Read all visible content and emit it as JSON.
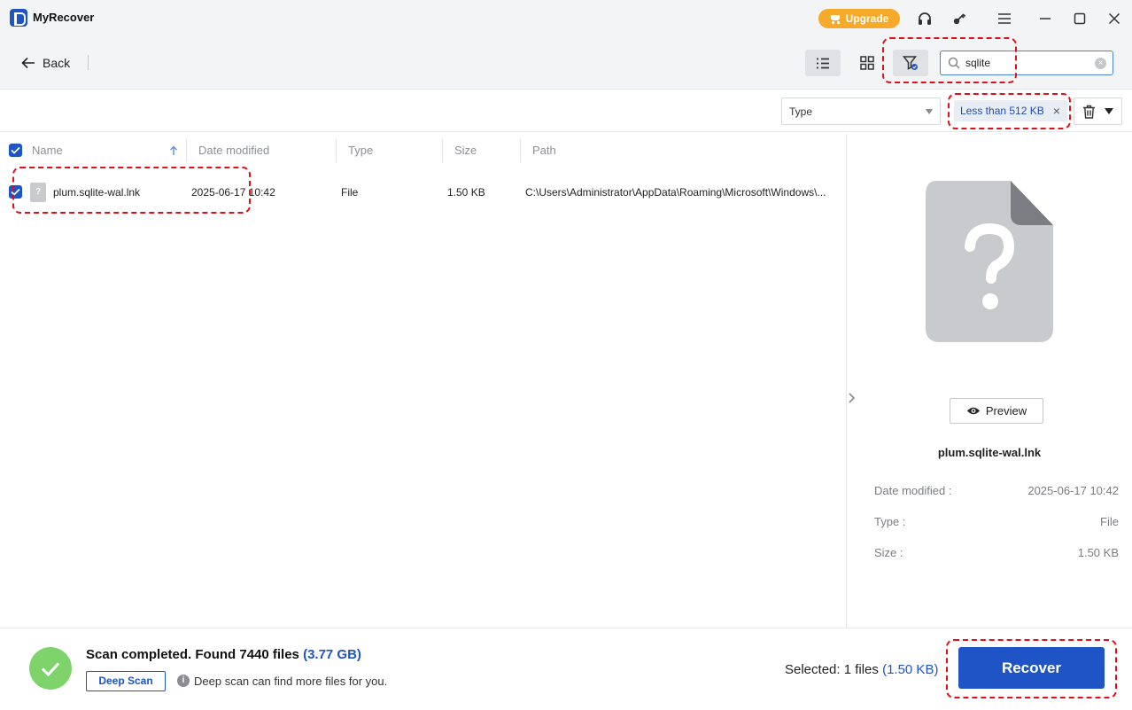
{
  "app": {
    "title": "MyRecover"
  },
  "titlebar": {
    "upgrade_label": "Upgrade",
    "icons": [
      "headset-icon",
      "key-icon",
      "menu-icon",
      "minimize-icon",
      "maximize-icon",
      "close-icon"
    ]
  },
  "toolbar": {
    "back_label": "Back",
    "search": {
      "value": "sqlite",
      "placeholder": ""
    }
  },
  "filters": {
    "type_select_value": "Type",
    "size_chip": "Less than 512 KB",
    "chip_close": "×"
  },
  "table": {
    "columns": [
      "Name",
      "Date modified",
      "Type",
      "Size",
      "Path"
    ],
    "rows": [
      {
        "name": "plum.sqlite-wal.lnk",
        "date": "2025-06-17 10:42",
        "type": "File",
        "size": "1.50 KB",
        "path": "C:\\Users\\Administrator\\AppData\\Roaming\\Microsoft\\Windows\\..."
      }
    ]
  },
  "preview": {
    "button_label": "Preview",
    "file_name": "plum.sqlite-wal.lnk",
    "fields": [
      {
        "label": "Date modified :",
        "value": "2025-06-17 10:42"
      },
      {
        "label": "Type :",
        "value": "File"
      },
      {
        "label": "Size :",
        "value": "1.50 KB"
      }
    ]
  },
  "footer": {
    "scan_status": "Scan completed. Found 7440 files",
    "scan_size": "(3.77 GB)",
    "deep_scan_label": "Deep Scan",
    "deep_scan_hint": "Deep scan can find more files for you.",
    "selected_prefix": "Selected: 1 files",
    "selected_size": "(1.50 KB)",
    "recover_label": "Recover"
  },
  "colors": {
    "accent": "#1f54c6",
    "upgrade": "#f7a929",
    "success": "#7ed36a",
    "annotation": "#e0101a"
  }
}
